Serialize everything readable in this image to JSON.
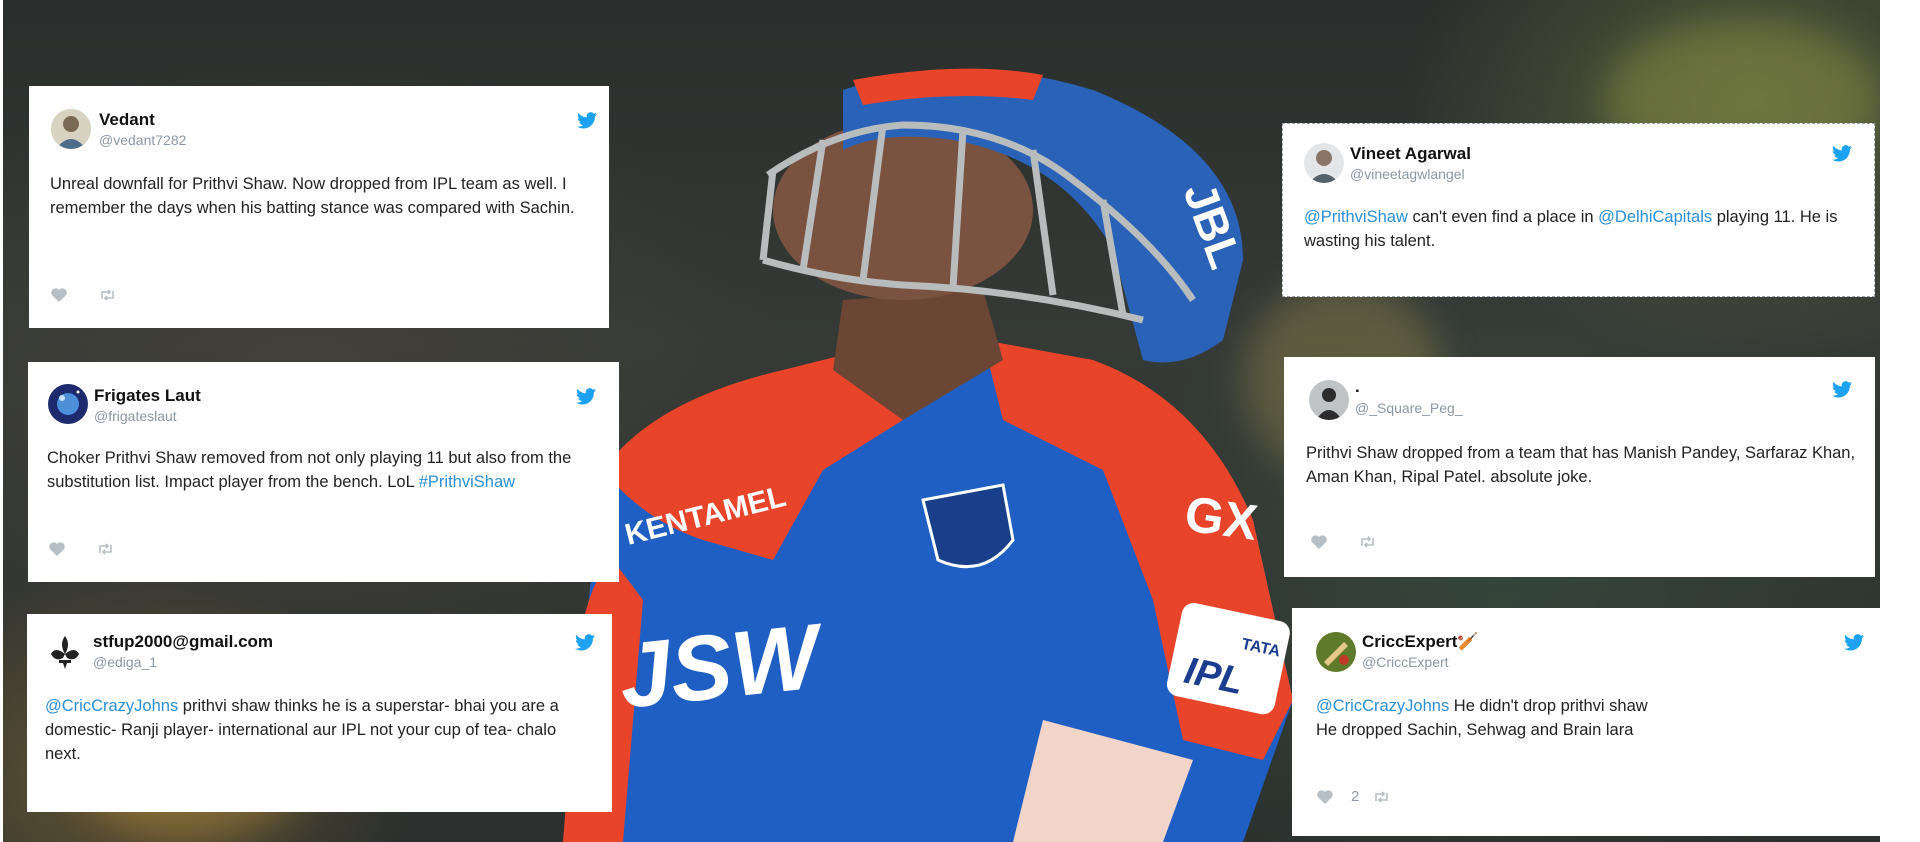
{
  "tweets": [
    {
      "name": "Vedant",
      "handle": "@vedant7282",
      "avatar_icon": "person-avatar-icon",
      "text": [
        {
          "t": "Unreal downfall for Prithvi Shaw. Now dropped from IPL team as well. I remember the days when his batting stance was compared with Sachin.",
          "m": false
        }
      ],
      "likes": ""
    },
    {
      "name": "Frigates Laut",
      "handle": "@frigateslaut",
      "avatar_icon": "planet-avatar-icon",
      "text": [
        {
          "t": "Choker Prithvi Shaw removed from not only playing 11 but also from the substitution list. Impact player from the bench. LoL ",
          "m": false
        },
        {
          "t": "#PrithviShaw",
          "m": true
        }
      ],
      "likes": ""
    },
    {
      "name": "stfup2000@gmail.com",
      "handle": "@ediga_1",
      "avatar_icon": "fleur-de-lis-avatar-icon",
      "text": [
        {
          "t": "@CricCrazyJohns",
          "m": true
        },
        {
          "t": " prithvi shaw thinks he is a superstar- bhai you are a domestic- Ranji player- international aur IPL not your cup of tea- chalo next.",
          "m": false
        }
      ],
      "likes": ""
    },
    {
      "name": "Vineet Agarwal",
      "handle": "@vineetagwlangel",
      "avatar_icon": "person-avatar-icon",
      "text": [
        {
          "t": "@PrithviShaw",
          "m": true
        },
        {
          "t": " can't even find a place in ",
          "m": false
        },
        {
          "t": "@DelhiCapitals",
          "m": true
        },
        {
          "t": " playing 11. He is wasting his talent.",
          "m": false
        }
      ],
      "likes": ""
    },
    {
      "name": ".",
      "handle": "@_Square_Peg_",
      "avatar_icon": "person-avatar-icon",
      "text": [
        {
          "t": "Prithvi Shaw dropped from a team that has Manish Pandey, Sarfaraz Khan, Aman Khan, Ripal Patel. absolute joke.",
          "m": false
        }
      ],
      "likes": ""
    },
    {
      "name": "CriccExpert🏏",
      "handle": "@CriccExpert",
      "avatar_icon": "cricket-avatar-icon",
      "text": [
        {
          "t": "@CricCrazyJohns",
          "m": true
        },
        {
          "t": " He didn't drop prithvi shaw\nHe dropped Sachin, Sehwag and Brain lara",
          "m": false
        }
      ],
      "likes": "2"
    }
  ],
  "jersey": {
    "sponsor": "JSW",
    "helmet_brand": "JBL",
    "sleeve": "GXX",
    "badge": "TATA IPL",
    "left_text": "KENTAMEL"
  },
  "colors": {
    "twitter_blue": "#1da1f2",
    "mention": "#2b8fd6",
    "jersey_blue": "#1f5fc4",
    "jersey_red": "#e8442a",
    "helmet_blue": "#2a62b8"
  }
}
